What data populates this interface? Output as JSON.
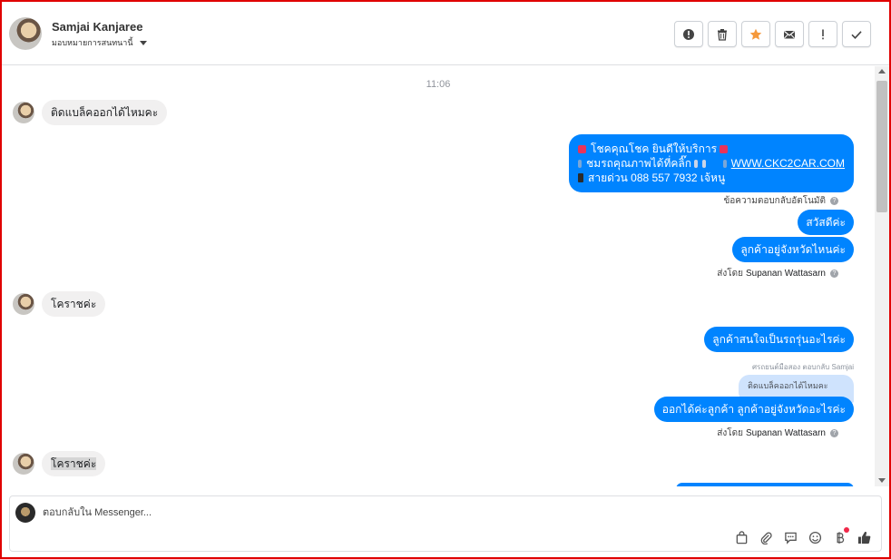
{
  "header": {
    "contact_name": "Samjai Kanjaree",
    "assign_label": "มอบหมายการสนทนานี้",
    "toolbar": [
      {
        "name": "spam-button",
        "icon": "alert-circle-icon"
      },
      {
        "name": "delete-button",
        "icon": "trash-icon"
      },
      {
        "name": "star-button",
        "icon": "star-icon"
      },
      {
        "name": "mark-unread-button",
        "icon": "envelope-icon"
      },
      {
        "name": "follow-up-button",
        "icon": "exclamation-icon"
      },
      {
        "name": "mark-done-button",
        "icon": "check-icon"
      }
    ]
  },
  "thread": {
    "time": "11:06",
    "msg_in_1": "ติดแบล็คออกได้ไหมคะ",
    "promo": {
      "line1": "โชคคุณโชค ยินดีให้บริการ",
      "line2a": "ชมรถคุณภาพได้ที่คลิ๊ก",
      "link": "WWW.CKC2CAR.COM",
      "line3": "สายด่วน 088 557 7932 เจ้หนู"
    },
    "auto_reply_label": "ข้อความตอบกลับอัตโนมัติ",
    "msg_out_1": "สวัสดีค่ะ",
    "msg_out_2": "ลูกค้าอยู่จังหวัดไหนค่ะ",
    "sent_by_label": "ส่งโดย",
    "agent_name": "Supanan Wattasarn",
    "msg_in_2": "โคราชค่ะ",
    "msg_out_3": "ลูกค้าสนใจเป็นรถรุ่นอะไรค่ะ",
    "reply_tag": "ศรถยนต์มือสอง ตอบกลับ Samjai",
    "quoted": "ติดแบล็คออกได้ไหมคะ",
    "msg_out_4": "ออกได้ค่ะลูกค้า ลูกค้าอยู่จังหวัดอะไรค่ะ",
    "msg_in_3": "โคราชค่ะ"
  },
  "composer": {
    "placeholder": "ตอบกลับใน Messenger..."
  },
  "colors": {
    "brand_blue": "#0084ff",
    "frame_red": "#e00000",
    "star_orange": "#f5993c"
  }
}
